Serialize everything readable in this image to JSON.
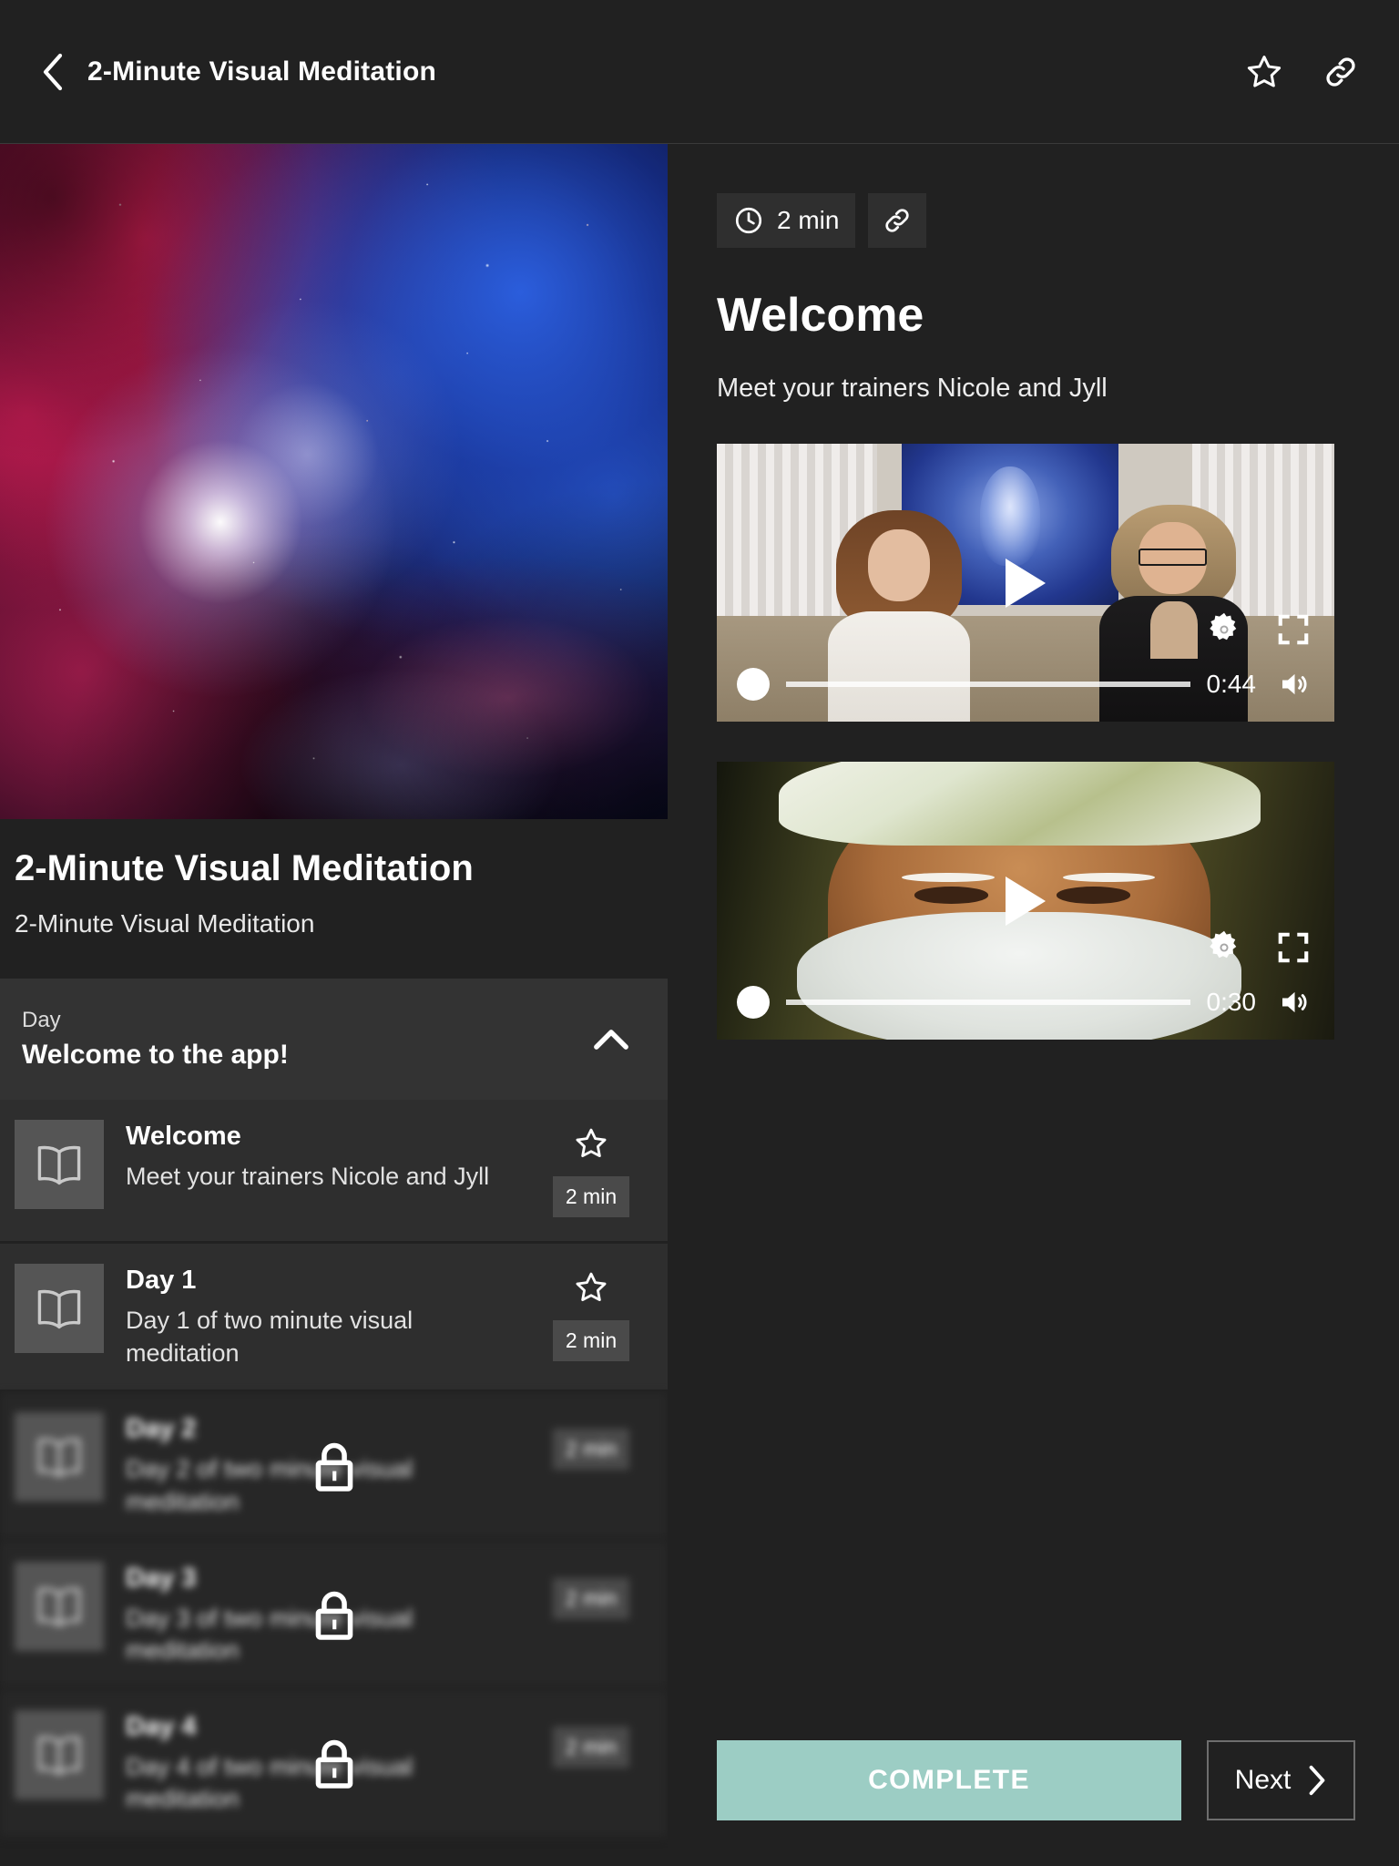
{
  "header": {
    "title": "2-Minute Visual Meditation",
    "back_icon": "chevron-left-icon",
    "favorite_icon": "star-outline-icon",
    "share_icon": "link-icon"
  },
  "course": {
    "hero_alt": "nebula-galaxy-image",
    "title": "2-Minute Visual Meditation",
    "subtitle": "2-Minute Visual Meditation"
  },
  "accordion": {
    "eyebrow": "Day",
    "title": "Welcome to the app!",
    "chevron_icon": "chevron-up-icon",
    "expanded": true
  },
  "lessons": [
    {
      "title": "Welcome",
      "subtitle": "Meet your trainers Nicole and Jyll",
      "duration": "2 min",
      "locked": false,
      "icon": "open-book-icon",
      "star_icon": "star-outline-icon"
    },
    {
      "title": "Day 1",
      "subtitle": "Day 1 of two minute visual meditation",
      "duration": "2 min",
      "locked": false,
      "icon": "open-book-icon",
      "star_icon": "star-outline-icon"
    },
    {
      "title": "Day 2",
      "subtitle": "Day 2 of two minute visual meditation",
      "duration": "2 min",
      "locked": true,
      "icon": "open-book-icon",
      "lock_icon": "lock-icon"
    },
    {
      "title": "Day 3",
      "subtitle": "Day 3 of two minute visual meditation",
      "duration": "2 min",
      "locked": true,
      "icon": "open-book-icon",
      "lock_icon": "lock-icon"
    },
    {
      "title": "Day 4",
      "subtitle": "Day 4 of two minute visual meditation",
      "duration": "2 min",
      "locked": true,
      "icon": "open-book-icon",
      "lock_icon": "lock-icon"
    }
  ],
  "detail": {
    "duration_chip": "2 min",
    "clock_icon": "clock-icon",
    "share_icon": "link-icon",
    "title": "Welcome",
    "description": "Meet your trainers Nicole and Jyll"
  },
  "videos": [
    {
      "scene": "two-women-meditation-studio",
      "time": "0:44",
      "play_icon": "play-icon",
      "settings_icon": "gear-icon",
      "fullscreen_icon": "fullscreen-icon",
      "volume_icon": "volume-icon",
      "progress_percent": 0
    },
    {
      "scene": "elder-man-white-turban",
      "time": "0:30",
      "play_icon": "play-icon",
      "settings_icon": "gear-icon",
      "fullscreen_icon": "fullscreen-icon",
      "volume_icon": "volume-icon",
      "progress_percent": 0
    }
  ],
  "footer": {
    "complete_label": "COMPLETE",
    "next_label": "Next",
    "next_icon": "chevron-right-icon"
  },
  "colors": {
    "background": "#212121",
    "panel": "#2e2e2e",
    "accordion": "#333333",
    "badge": "#4a4a4a",
    "accent": "#9ccdc4"
  }
}
